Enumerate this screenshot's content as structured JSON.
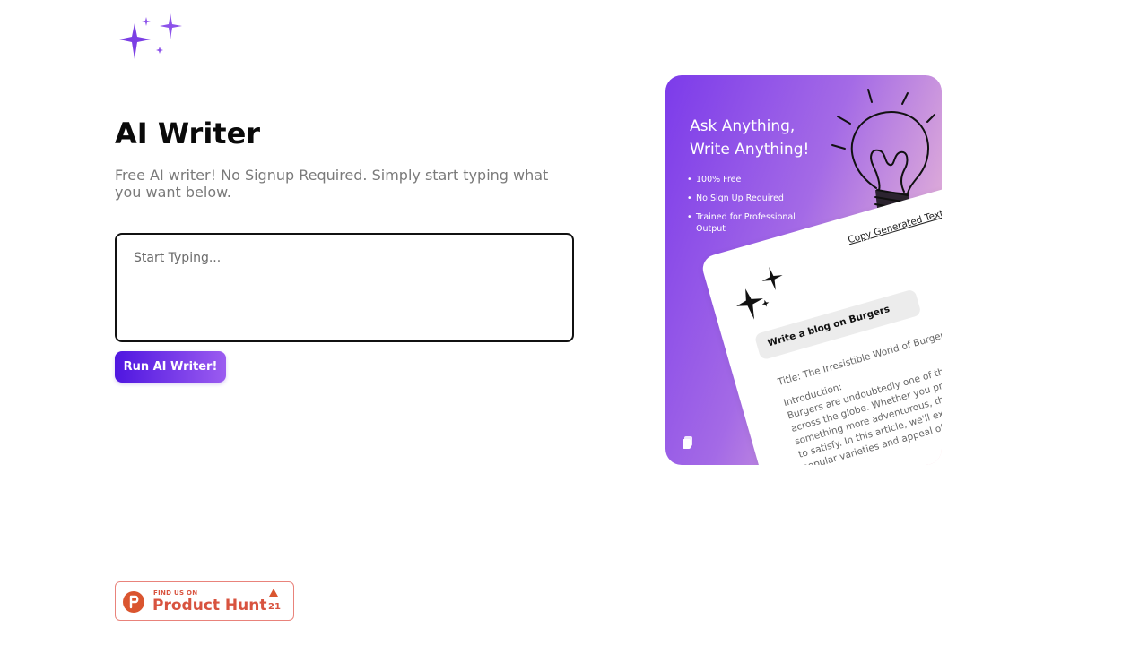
{
  "header": {
    "logo_icon": "sparkles-icon",
    "accent_color": "#7b3fe4"
  },
  "main": {
    "title": "AI Writer",
    "subtitle": "Free AI writer! No Signup Required. Simply start typing what you want below.",
    "prompt": {
      "placeholder": "Start Typing...",
      "value": ""
    },
    "run_button": "Run AI Writer!"
  },
  "promo": {
    "headline_line1": "Ask Anything,",
    "headline_line2": "Write Anything!",
    "features": [
      "100% Free",
      "No Sign Up Required",
      "Trained for Professional Output"
    ],
    "copy_link": "Copy Generated Text",
    "example_prompt": "Write a blog on Burgers",
    "generated_title": "Title: The Irresistible World of Burgers",
    "intro_label": "Introduction:",
    "generated_body": "Burgers are undoubtedly one of the most beloved foods across the globe. Whether you prefer a classic or opt for something more adventurous, there's a burger out there to satisfy. In this article, we'll explore the history, popular varieties and appeal of this culinary sensation.",
    "icons": [
      "lightbulb-icon",
      "sparkles-icon",
      "clipboard-icon"
    ]
  },
  "badge": {
    "find_us_on": "FIND US ON",
    "name": "Product Hunt",
    "count": "21",
    "brand_color": "#da552f"
  }
}
